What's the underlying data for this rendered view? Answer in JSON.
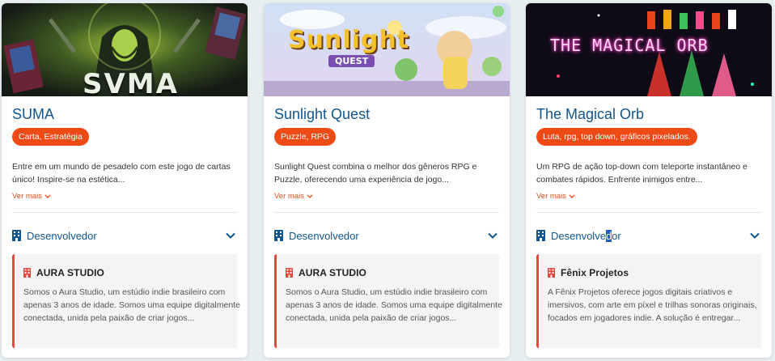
{
  "cards": [
    {
      "title": "SUMA",
      "tags": "Carta, Estratégia",
      "description": "Entre em um mundo de pesadelo com este jogo de cartas único! Inspire-se na estética...",
      "more_label": "Ver mais",
      "dev_label_pre": "Desenvolvedor",
      "dev_label_sel": "",
      "dev_label_post": "",
      "studio_name": "AURA STUDIO",
      "studio_desc": "Somos o Aura Studio, um estúdio indie brasileiro com apenas 3 anos de idade. Somos uma equipe digitalmente conectada, unida pela paixão de criar jogos...",
      "cover_text": "SVMA"
    },
    {
      "title": "Sunlight Quest",
      "tags": "Puzzle, RPG",
      "description": "Sunlight Quest combina o melhor dos gêneros RPG e Puzzle, oferecendo uma experiência de jogo...",
      "more_label": "Ver mais",
      "dev_label_pre": "Desenvolvedor",
      "dev_label_sel": "",
      "dev_label_post": "",
      "studio_name": "AURA STUDIO",
      "studio_desc": "Somos o Aura Studio, um estúdio indie brasileiro com apenas 3 anos de idade. Somos uma equipe digitalmente conectada, unida pela paixão de criar jogos...",
      "cover_text": "Sunlight",
      "cover_subtext": "QUEST"
    },
    {
      "title": "The Magical Orb",
      "tags": "Luta, rpg, top down, gráficos pixelados.",
      "description": "Um RPG de ação top-down com teleporte instantâneo e combates rápidos. Enfrente inimigos entre...",
      "more_label": "Ver mais",
      "dev_label_pre": "Desenvolve",
      "dev_label_sel": "d",
      "dev_label_post": "or",
      "studio_name": "Fênix Projetos",
      "studio_desc": "A Fênix Projetos oferece jogos digitais criativos e imersivos, com arte em píxel e trilhas sonoras originais, focados em jogadores indie. A solução é entregar...",
      "cover_text": "THE MAGICAL ORB"
    }
  ],
  "colors": {
    "title": "#10558d",
    "tag_bg": "#ee4a16",
    "more": "#e8501a",
    "studio_border": "#e04a3a",
    "building_icon_dev": "#10558d",
    "building_icon_studio": "#e04a3a"
  }
}
